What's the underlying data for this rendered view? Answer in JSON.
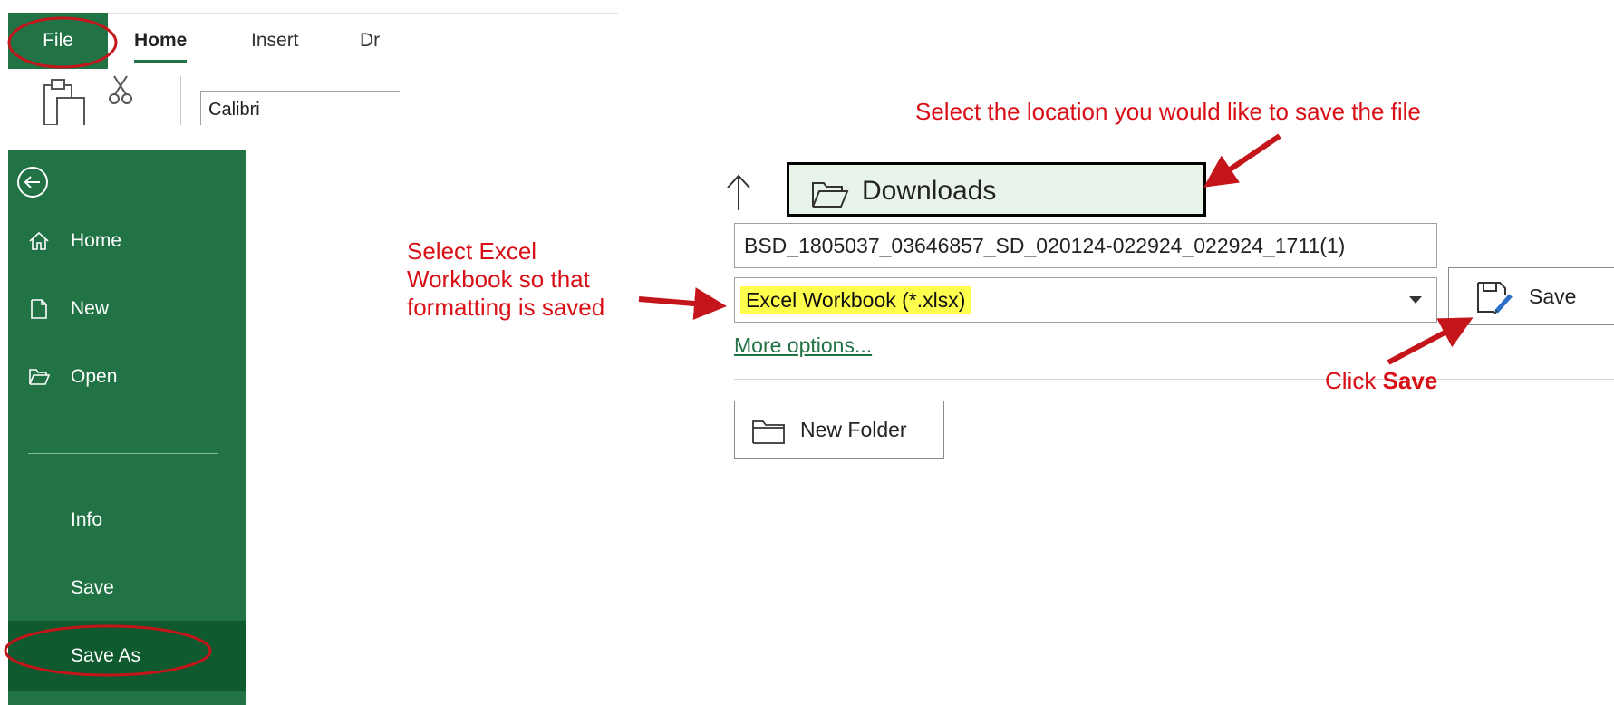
{
  "colors": {
    "excel_green": "#217346",
    "active_green": "#0f5a2e",
    "annotation_red": "#d90f16",
    "highlight_yellow": "#ffff4d"
  },
  "ribbon": {
    "file_tab": "File",
    "tabs": [
      "Home",
      "Insert",
      "Dr"
    ],
    "font_name": "Calibri",
    "icons": [
      "paste-icon",
      "cut-icon"
    ]
  },
  "sidebar": {
    "items": [
      {
        "label": "Home",
        "icon": "home-icon"
      },
      {
        "label": "New",
        "icon": "new-document-icon"
      },
      {
        "label": "Open",
        "icon": "open-folder-icon"
      },
      {
        "label": "Info"
      },
      {
        "label": "Save"
      },
      {
        "label": "Save As",
        "active": true
      }
    ]
  },
  "save_as": {
    "location": "Downloads",
    "filename": "BSD_1805037_03646857_SD_020124-022924_022924_1711(1)",
    "file_type": "Excel Workbook (*.xlsx)",
    "more_options": "More options...",
    "save_button": "Save",
    "new_folder_button": "New Folder"
  },
  "annotations": {
    "location_note": "Select the location you would like to save the file",
    "excel_note_line1": "Select Excel",
    "excel_note_line2": "Workbook so that",
    "excel_note_line3": "formatting is saved",
    "click_prefix": "Click ",
    "click_bold": "Save"
  }
}
